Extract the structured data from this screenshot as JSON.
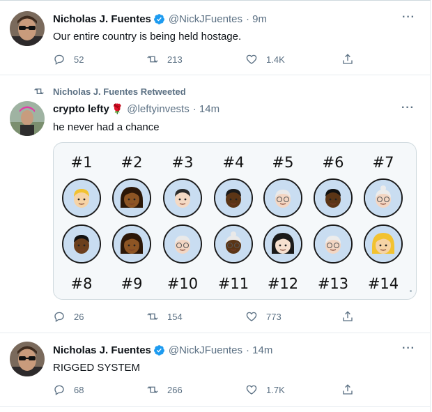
{
  "tweets": [
    {
      "name": "Nicholas J. Fuentes",
      "handle": "@NickJFuentes",
      "time": "· 9m",
      "text": "Our entire country is being held hostage.",
      "replies": "52",
      "retweets": "213",
      "likes": "1.4K"
    },
    {
      "retweet_label": "Nicholas J. Fuentes Retweeted",
      "name": "crypto lefty",
      "name_emoji": "🌹",
      "handle": "@leftyinvests",
      "time": "· 14m",
      "text": "he never had a chance",
      "replies": "26",
      "retweets": "154",
      "likes": "773",
      "media": {
        "row1_labels": [
          "#1",
          "#2",
          "#3",
          "#4",
          "#5",
          "#6",
          "#7"
        ],
        "row2_labels": [
          "#8",
          "#9",
          "#10",
          "#11",
          "#12",
          "#13",
          "#14"
        ],
        "row1_faces": [
          {
            "skin": "#f6d3a5",
            "hair": "#f2c230",
            "type": "short"
          },
          {
            "skin": "#8d5524",
            "hair": "#2b1708",
            "type": "long"
          },
          {
            "skin": "#f4d9c4",
            "hair": "#2b2b2b",
            "type": "short"
          },
          {
            "skin": "#5b3516",
            "hair": "#1a1a1a",
            "type": "short"
          },
          {
            "skin": "#f3d6c3",
            "hair": "#e9e9e9",
            "type": "bald-glasses"
          },
          {
            "skin": "#5b3516",
            "hair": "#111111",
            "type": "short"
          },
          {
            "skin": "#f3d6c3",
            "hair": "#ececec",
            "type": "bun-glasses"
          }
        ],
        "row2_faces": [
          {
            "skin": "#6b3f1d",
            "hair": "#111111",
            "type": "short"
          },
          {
            "skin": "#8d5524",
            "hair": "#2b1708",
            "type": "long"
          },
          {
            "skin": "#f3d6c3",
            "hair": "#e9e9e9",
            "type": "bald-glasses"
          },
          {
            "skin": "#5b3516",
            "hair": "#e9e9e9",
            "type": "bun-glasses"
          },
          {
            "skin": "#f6e0cf",
            "hair": "#1a1a1a",
            "type": "long"
          },
          {
            "skin": "#f3d6c3",
            "hair": "#ececec",
            "type": "bald-glasses"
          },
          {
            "skin": "#f6d3a5",
            "hair": "#f2c230",
            "type": "long"
          }
        ]
      }
    },
    {
      "name": "Nicholas J. Fuentes",
      "handle": "@NickJFuentes",
      "time": "· 14m",
      "text": "RIGGED SYSTEM",
      "replies": "68",
      "retweets": "266",
      "likes": "1.7K"
    }
  ],
  "icons": {
    "verified": "verified-badge-icon",
    "more": "more-options-icon",
    "reply": "reply-icon",
    "retweet": "retweet-icon",
    "like": "like-icon",
    "share": "share-icon"
  },
  "colors": {
    "accent": "#1d9bf0",
    "muted": "#5b7083",
    "like_heart": "#5b7083"
  },
  "more_glyph": "···"
}
